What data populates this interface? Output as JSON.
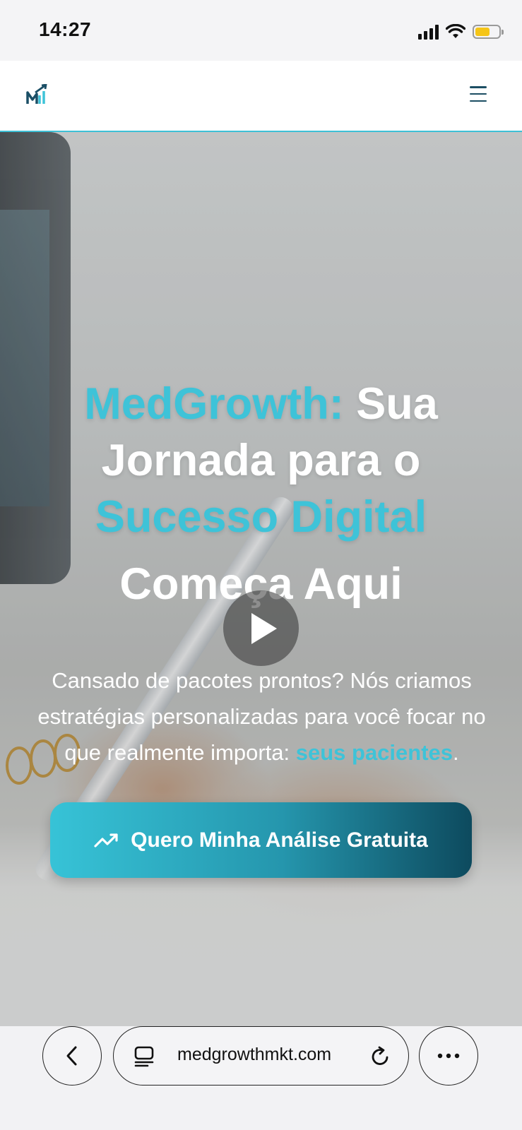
{
  "status_bar": {
    "time": "14:27"
  },
  "header": {
    "logo": "MedGrowth logo",
    "menu_icon": "hamburger-icon"
  },
  "hero": {
    "headline_accent_1": "MedGrowth:",
    "headline_part_1": " Sua Jornada para o ",
    "headline_accent_2": "Sucesso Digital",
    "headline_part_2": "Começa Aqui",
    "subtext_main": "Cansado de pacotes prontos? Nós criamos estratégias personalizadas para você focar no que realmente importa: ",
    "subtext_accent": "seus pacientes",
    "subtext_end": ".",
    "cta_label": "Quero Minha Análise Gratuita",
    "cta_icon": "trending-up-icon",
    "play_icon": "play-icon"
  },
  "browser": {
    "url": "medgrowthmkt.com"
  },
  "colors": {
    "accent": "#3ec3d8",
    "brand_dark": "#0d4a5e"
  }
}
